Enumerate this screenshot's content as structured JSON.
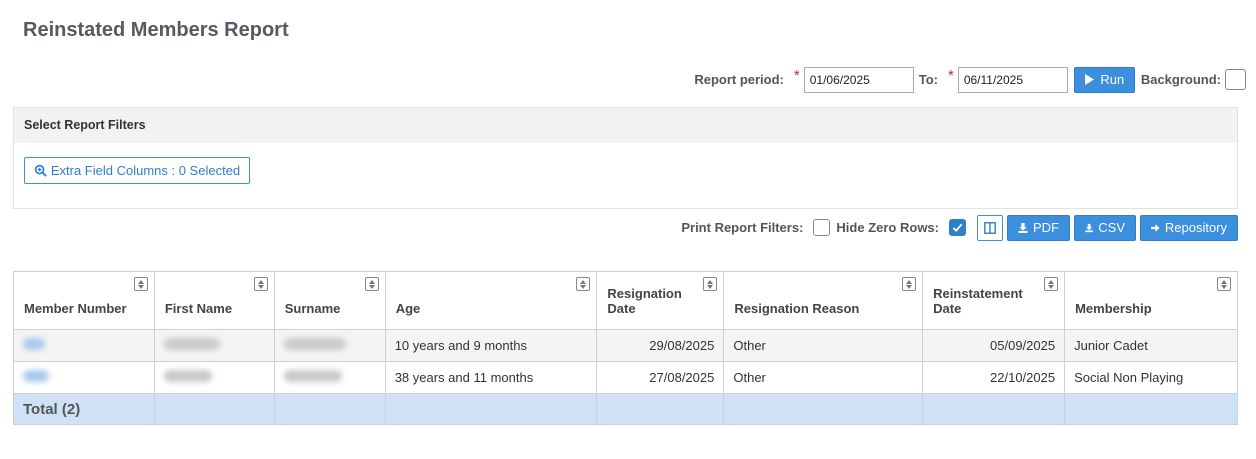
{
  "page": {
    "title": "Reinstated Members Report"
  },
  "period": {
    "label": "Report period:",
    "from_value": "01/06/2025",
    "to_label": "To:",
    "to_value": "06/11/2025",
    "run_label": "Run",
    "background_label": "Background:"
  },
  "filters": {
    "heading": "Select Report Filters",
    "extra_fields_label": "Extra Field Columns : 0 Selected"
  },
  "toolbar": {
    "print_filters_label": "Print Report Filters:",
    "print_filters_checked": false,
    "hide_zero_label": "Hide Zero Rows:",
    "hide_zero_checked": true,
    "pdf_label": "PDF",
    "csv_label": "CSV",
    "repository_label": "Repository"
  },
  "table": {
    "headers": [
      "Member Number",
      "First Name",
      "Surname",
      "Age",
      "Resignation Date",
      "Resignation Reason",
      "Reinstatement Date",
      "Membership"
    ],
    "rows": [
      {
        "age": "10 years and 9 months",
        "resignation_date": "29/08/2025",
        "reason": "Other",
        "reinstatement_date": "05/09/2025",
        "membership": "Junior Cadet"
      },
      {
        "age": "38 years and 11 months",
        "resignation_date": "27/08/2025",
        "reason": "Other",
        "reinstatement_date": "22/10/2025",
        "membership": "Social Non Playing"
      }
    ],
    "total_label": "Total (2)"
  },
  "colors": {
    "accent": "#3b8fdc",
    "total_row": "#cfe2f5",
    "required": "#b5322a"
  },
  "icons": [
    "play-icon",
    "search-plus-icon",
    "columns-icon",
    "download-icon",
    "arrow-right-icon",
    "sort-icon",
    "check-icon"
  ]
}
